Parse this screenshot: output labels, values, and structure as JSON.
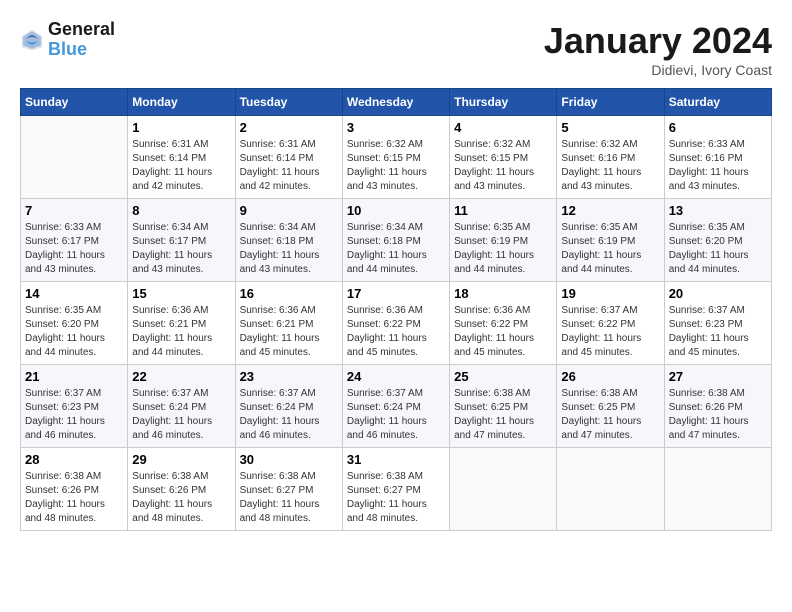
{
  "header": {
    "logo_line1": "General",
    "logo_line2": "Blue",
    "month_title": "January 2024",
    "location": "Didievi, Ivory Coast"
  },
  "days_of_week": [
    "Sunday",
    "Monday",
    "Tuesday",
    "Wednesday",
    "Thursday",
    "Friday",
    "Saturday"
  ],
  "weeks": [
    [
      {
        "num": "",
        "sunrise": "",
        "sunset": "",
        "daylight": ""
      },
      {
        "num": "1",
        "sunrise": "Sunrise: 6:31 AM",
        "sunset": "Sunset: 6:14 PM",
        "daylight": "Daylight: 11 hours and 42 minutes."
      },
      {
        "num": "2",
        "sunrise": "Sunrise: 6:31 AM",
        "sunset": "Sunset: 6:14 PM",
        "daylight": "Daylight: 11 hours and 42 minutes."
      },
      {
        "num": "3",
        "sunrise": "Sunrise: 6:32 AM",
        "sunset": "Sunset: 6:15 PM",
        "daylight": "Daylight: 11 hours and 43 minutes."
      },
      {
        "num": "4",
        "sunrise": "Sunrise: 6:32 AM",
        "sunset": "Sunset: 6:15 PM",
        "daylight": "Daylight: 11 hours and 43 minutes."
      },
      {
        "num": "5",
        "sunrise": "Sunrise: 6:32 AM",
        "sunset": "Sunset: 6:16 PM",
        "daylight": "Daylight: 11 hours and 43 minutes."
      },
      {
        "num": "6",
        "sunrise": "Sunrise: 6:33 AM",
        "sunset": "Sunset: 6:16 PM",
        "daylight": "Daylight: 11 hours and 43 minutes."
      }
    ],
    [
      {
        "num": "7",
        "sunrise": "Sunrise: 6:33 AM",
        "sunset": "Sunset: 6:17 PM",
        "daylight": "Daylight: 11 hours and 43 minutes."
      },
      {
        "num": "8",
        "sunrise": "Sunrise: 6:34 AM",
        "sunset": "Sunset: 6:17 PM",
        "daylight": "Daylight: 11 hours and 43 minutes."
      },
      {
        "num": "9",
        "sunrise": "Sunrise: 6:34 AM",
        "sunset": "Sunset: 6:18 PM",
        "daylight": "Daylight: 11 hours and 43 minutes."
      },
      {
        "num": "10",
        "sunrise": "Sunrise: 6:34 AM",
        "sunset": "Sunset: 6:18 PM",
        "daylight": "Daylight: 11 hours and 44 minutes."
      },
      {
        "num": "11",
        "sunrise": "Sunrise: 6:35 AM",
        "sunset": "Sunset: 6:19 PM",
        "daylight": "Daylight: 11 hours and 44 minutes."
      },
      {
        "num": "12",
        "sunrise": "Sunrise: 6:35 AM",
        "sunset": "Sunset: 6:19 PM",
        "daylight": "Daylight: 11 hours and 44 minutes."
      },
      {
        "num": "13",
        "sunrise": "Sunrise: 6:35 AM",
        "sunset": "Sunset: 6:20 PM",
        "daylight": "Daylight: 11 hours and 44 minutes."
      }
    ],
    [
      {
        "num": "14",
        "sunrise": "Sunrise: 6:35 AM",
        "sunset": "Sunset: 6:20 PM",
        "daylight": "Daylight: 11 hours and 44 minutes."
      },
      {
        "num": "15",
        "sunrise": "Sunrise: 6:36 AM",
        "sunset": "Sunset: 6:21 PM",
        "daylight": "Daylight: 11 hours and 44 minutes."
      },
      {
        "num": "16",
        "sunrise": "Sunrise: 6:36 AM",
        "sunset": "Sunset: 6:21 PM",
        "daylight": "Daylight: 11 hours and 45 minutes."
      },
      {
        "num": "17",
        "sunrise": "Sunrise: 6:36 AM",
        "sunset": "Sunset: 6:22 PM",
        "daylight": "Daylight: 11 hours and 45 minutes."
      },
      {
        "num": "18",
        "sunrise": "Sunrise: 6:36 AM",
        "sunset": "Sunset: 6:22 PM",
        "daylight": "Daylight: 11 hours and 45 minutes."
      },
      {
        "num": "19",
        "sunrise": "Sunrise: 6:37 AM",
        "sunset": "Sunset: 6:22 PM",
        "daylight": "Daylight: 11 hours and 45 minutes."
      },
      {
        "num": "20",
        "sunrise": "Sunrise: 6:37 AM",
        "sunset": "Sunset: 6:23 PM",
        "daylight": "Daylight: 11 hours and 45 minutes."
      }
    ],
    [
      {
        "num": "21",
        "sunrise": "Sunrise: 6:37 AM",
        "sunset": "Sunset: 6:23 PM",
        "daylight": "Daylight: 11 hours and 46 minutes."
      },
      {
        "num": "22",
        "sunrise": "Sunrise: 6:37 AM",
        "sunset": "Sunset: 6:24 PM",
        "daylight": "Daylight: 11 hours and 46 minutes."
      },
      {
        "num": "23",
        "sunrise": "Sunrise: 6:37 AM",
        "sunset": "Sunset: 6:24 PM",
        "daylight": "Daylight: 11 hours and 46 minutes."
      },
      {
        "num": "24",
        "sunrise": "Sunrise: 6:37 AM",
        "sunset": "Sunset: 6:24 PM",
        "daylight": "Daylight: 11 hours and 46 minutes."
      },
      {
        "num": "25",
        "sunrise": "Sunrise: 6:38 AM",
        "sunset": "Sunset: 6:25 PM",
        "daylight": "Daylight: 11 hours and 47 minutes."
      },
      {
        "num": "26",
        "sunrise": "Sunrise: 6:38 AM",
        "sunset": "Sunset: 6:25 PM",
        "daylight": "Daylight: 11 hours and 47 minutes."
      },
      {
        "num": "27",
        "sunrise": "Sunrise: 6:38 AM",
        "sunset": "Sunset: 6:26 PM",
        "daylight": "Daylight: 11 hours and 47 minutes."
      }
    ],
    [
      {
        "num": "28",
        "sunrise": "Sunrise: 6:38 AM",
        "sunset": "Sunset: 6:26 PM",
        "daylight": "Daylight: 11 hours and 48 minutes."
      },
      {
        "num": "29",
        "sunrise": "Sunrise: 6:38 AM",
        "sunset": "Sunset: 6:26 PM",
        "daylight": "Daylight: 11 hours and 48 minutes."
      },
      {
        "num": "30",
        "sunrise": "Sunrise: 6:38 AM",
        "sunset": "Sunset: 6:27 PM",
        "daylight": "Daylight: 11 hours and 48 minutes."
      },
      {
        "num": "31",
        "sunrise": "Sunrise: 6:38 AM",
        "sunset": "Sunset: 6:27 PM",
        "daylight": "Daylight: 11 hours and 48 minutes."
      },
      {
        "num": "",
        "sunrise": "",
        "sunset": "",
        "daylight": ""
      },
      {
        "num": "",
        "sunrise": "",
        "sunset": "",
        "daylight": ""
      },
      {
        "num": "",
        "sunrise": "",
        "sunset": "",
        "daylight": ""
      }
    ]
  ]
}
